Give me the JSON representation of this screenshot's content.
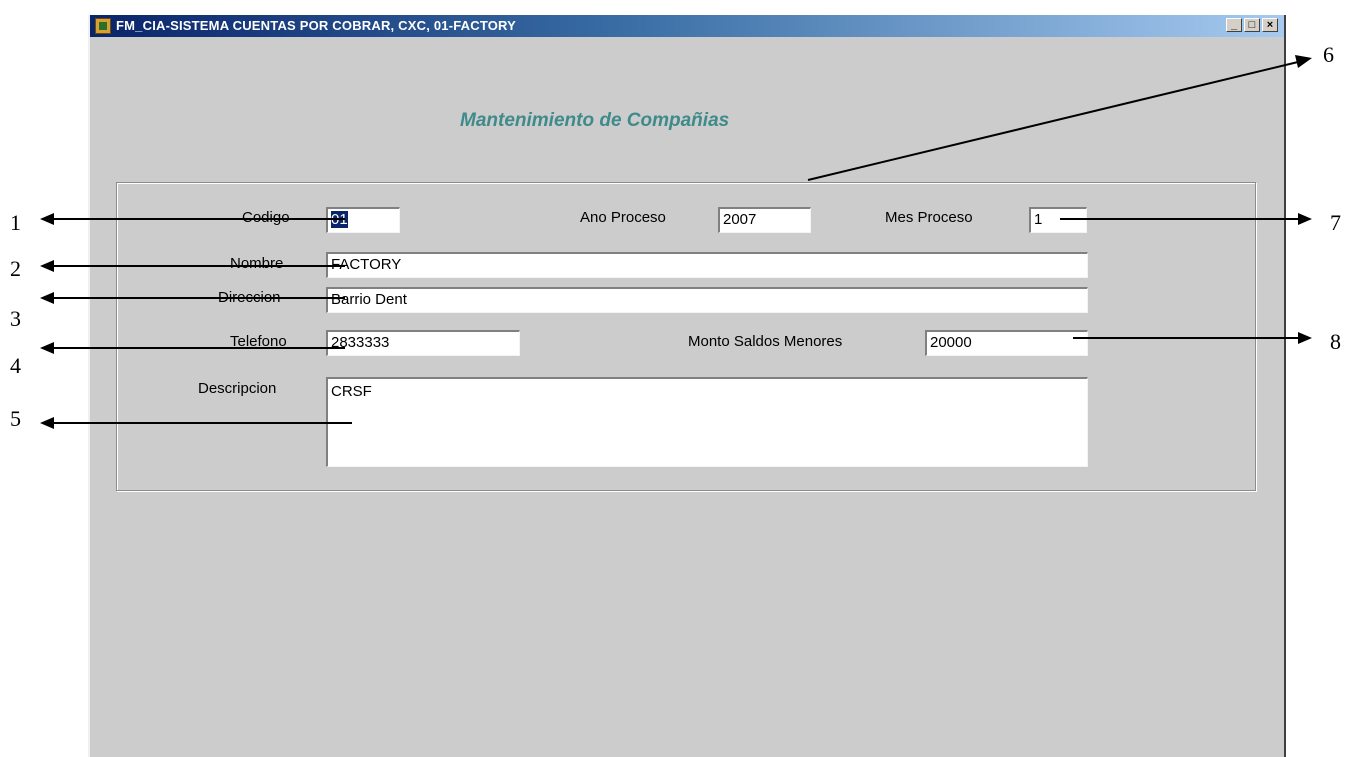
{
  "window": {
    "title": "FM_CIA-SISTEMA CUENTAS POR COBRAR, CXC, 01-FACTORY",
    "controls": {
      "minimize": "_",
      "maximize": "□",
      "close": "×"
    }
  },
  "form": {
    "title": "Mantenimiento de Compañias",
    "codigo": {
      "label": "Codigo",
      "value": "01"
    },
    "ano_proceso": {
      "label": "Ano Proceso",
      "value": "2007"
    },
    "mes_proceso": {
      "label": "Mes Proceso",
      "value": "1"
    },
    "nombre": {
      "label": "Nombre",
      "value": "FACTORY"
    },
    "direccion": {
      "label": "Direccion",
      "value": "Barrio Dent"
    },
    "telefono": {
      "label": "Telefono",
      "value": "2833333"
    },
    "monto_saldos_menores": {
      "label": "Monto Saldos Menores",
      "value": "20000"
    },
    "descripcion": {
      "label": "Descripcion",
      "value": "CRSF"
    }
  },
  "annotations": [
    "1",
    "2",
    "3",
    "4",
    "5",
    "6",
    "7",
    "8"
  ]
}
